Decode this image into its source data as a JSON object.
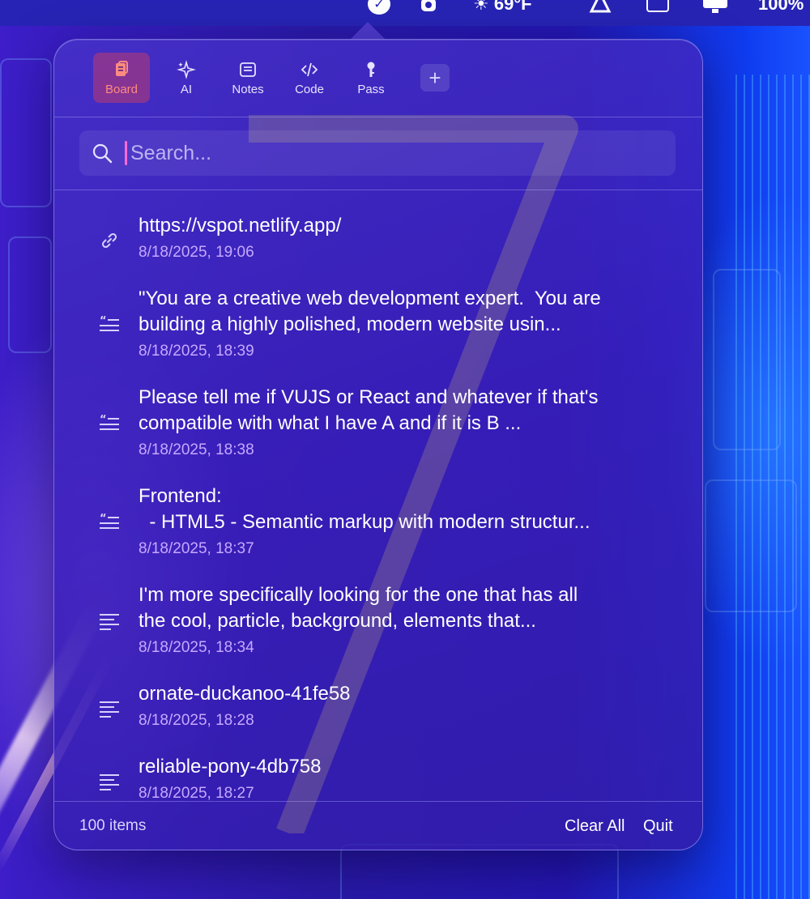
{
  "menubar": {
    "temperature": "69°F",
    "battery": "100%"
  },
  "tabs": [
    {
      "label": "Board",
      "icon": "clipboard-icon"
    },
    {
      "label": "AI",
      "icon": "sparkles-icon"
    },
    {
      "label": "Notes",
      "icon": "notes-icon"
    },
    {
      "label": "Code",
      "icon": "code-icon"
    },
    {
      "label": "Pass",
      "icon": "key-icon"
    }
  ],
  "add_tab_label": "+",
  "search": {
    "placeholder": "Search..."
  },
  "items": [
    {
      "icon": "link-icon",
      "text": "https://vspot.netlify.app/",
      "time": "8/18/2025, 19:06"
    },
    {
      "icon": "quote-icon",
      "text": "\"You are a creative web development expert.  You are\nbuilding a highly polished, modern website usin...",
      "time": "8/18/2025, 18:39"
    },
    {
      "icon": "quote-icon",
      "text": "Please tell me if VUJS or React and whatever if that's\ncompatible with what I have A and if it is B ...",
      "time": "8/18/2025, 18:38"
    },
    {
      "icon": "quote-icon",
      "text": "Frontend:\n  - HTML5 - Semantic markup with modern structur...",
      "time": "8/18/2025, 18:37"
    },
    {
      "icon": "text-icon",
      "text": "I'm more specifically looking for the one that has all\nthe cool, particle, background, elements that...",
      "time": "8/18/2025, 18:34"
    },
    {
      "icon": "text-icon",
      "text": "ornate-duckanoo-41fe58",
      "time": "8/18/2025, 18:28"
    },
    {
      "icon": "text-icon",
      "text": "reliable-pony-4db758",
      "time": "8/18/2025, 18:27"
    }
  ],
  "footer": {
    "count": "100 items",
    "clear_all": "Clear All",
    "quit": "Quit"
  },
  "colors": {
    "accent": "#ff8a80",
    "timestamp": "#c6a9ff",
    "caret": "#ff6ad5"
  }
}
